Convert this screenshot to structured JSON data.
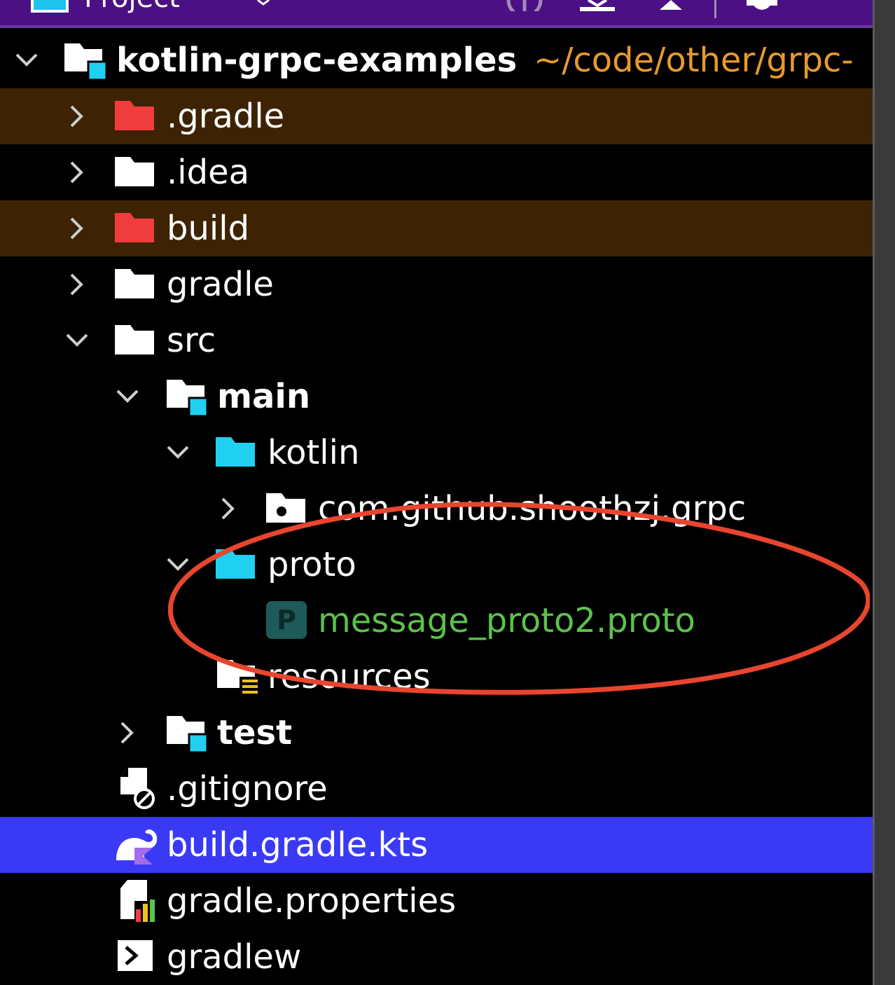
{
  "toolbar": {
    "title": "Project"
  },
  "tree": {
    "root": {
      "label": "kotlin-grpc-examples",
      "path": "~/code/other/grpc-"
    },
    "items": [
      {
        "label": ".gradle"
      },
      {
        "label": ".idea"
      },
      {
        "label": "build"
      },
      {
        "label": "gradle"
      },
      {
        "label": "src"
      },
      {
        "label": "main"
      },
      {
        "label": "kotlin"
      },
      {
        "label": "com.github.shoothzj.grpc"
      },
      {
        "label": "proto"
      },
      {
        "label": "message_proto2.proto"
      },
      {
        "label": "resources"
      },
      {
        "label": "test"
      },
      {
        "label": ".gitignore"
      },
      {
        "label": "build.gradle.kts"
      },
      {
        "label": "gradle.properties"
      },
      {
        "label": "gradlew"
      }
    ]
  },
  "icons": {
    "proto_file_letter": "P"
  },
  "colors": {
    "toolbar": "#4b1083",
    "excluded_row": "#3d2304",
    "selected_row": "#3a3af5",
    "excluded_folder": "#f03c3c",
    "source_folder": "#1fd0f0",
    "proto_file_text": "#5cc24a",
    "root_path": "#e69a2c",
    "annotation": "#e8452f"
  }
}
